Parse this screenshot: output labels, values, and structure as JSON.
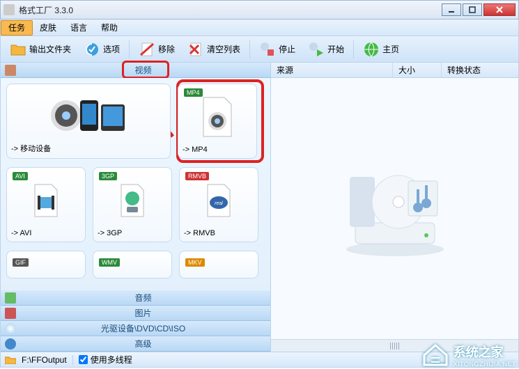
{
  "window": {
    "title": "格式工厂 3.3.0"
  },
  "menu": {
    "task": "任务",
    "skin": "皮肤",
    "lang": "语言",
    "help": "帮助"
  },
  "toolbar": {
    "output_folder": "输出文件夹",
    "options": "选项",
    "remove": "移除",
    "clear_list": "清空列表",
    "stop": "停止",
    "start": "开始",
    "home": "主页"
  },
  "categories": {
    "video": "视频",
    "audio": "音频",
    "image": "图片",
    "disc": "光驱设备\\DVD\\CD\\ISO",
    "advanced": "高级"
  },
  "formats": {
    "mobile": "-> 移动设备",
    "mp4": "-> MP4",
    "mp4_badge": "MP4",
    "avi": "-> AVI",
    "avi_badge": "AVI",
    "3gp": "-> 3GP",
    "3gp_badge": "3GP",
    "rmvb": "-> RMVB",
    "rmvb_badge": "RMVB",
    "gif_badge": "GIF",
    "wmv_badge": "WMV",
    "mkv_badge": "MKV"
  },
  "columns": {
    "source": "来源",
    "size": "大小",
    "status": "转换状态"
  },
  "status": {
    "output_path": "F:\\FFOutput",
    "multithread": "使用多线程"
  },
  "watermark": {
    "brand": "系统之家",
    "url": "XITONGZHIJIA.NET"
  }
}
